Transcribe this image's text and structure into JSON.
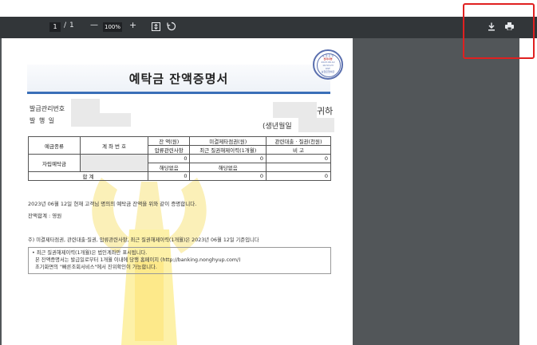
{
  "toolbar": {
    "page_current": "1",
    "page_separator": "/",
    "page_total": "1",
    "zoom_out_label": "—",
    "zoom_value": "100%",
    "zoom_in_label": "+",
    "fit_icon": "fit-page-icon",
    "rotate_icon": "rotate-icon",
    "download_icon": "download-icon",
    "print_icon": "print-icon"
  },
  "document": {
    "title": "예탁금 잔액증명서",
    "issue_no_label": "발급관리번호",
    "issue_date_label": "발   행   일",
    "recipient_suffix": "귀하",
    "birth_label": "(생년월일",
    "seal": {
      "line1": "농 협 은 행",
      "line2": "전자서명",
      "line3": "2023.06.12",
      "line4": "16:53:23",
      "line5": "KST",
      "line6": "농협은행예금"
    },
    "table": {
      "h_deposit_type": "예금종류",
      "h_account_no": "계 좌 번 호",
      "h_balance": "잔 액(원)",
      "h_pledge": "압류관련사항",
      "h_unsettled": "미결제타점권(원)",
      "h_recent": "최근 질권해제이력(1개월)",
      "h_loan": "관련대출 · 질권(천원)",
      "h_remark": "비   고",
      "row_type": "자립예탁금",
      "row_balance": "0",
      "row_unsettled": "0",
      "row_loan": "0",
      "row_none1": "해당없음",
      "row_none2": "해당없음",
      "total_label": "합   계",
      "total_balance": "0",
      "total_unsettled": "0",
      "total_loan": "0"
    },
    "statement": "2023년 06월 12일 현재 고객님 명의의 예탁금 잔액을 위와 같이 증명합니다.",
    "total_text": "잔액합계 : 영원",
    "footnote": "주) 미결제타점권, 관련대출·질권, 압류관련사항, 최근 질권해제이력(1개월)은 2023년 06월 12일 기준입니다",
    "note1": "• 최근 질권해제이력(1개월)은 법인계좌만 표시됩니다.",
    "note2": "  본 잔액증명서는 발급일로부터 1개월 이내에 당행 홈페이지 (http://banking.nonghyup.com/)",
    "note3": "  초기화면의 \"빠른조회서비스\"에서 진위확인이 가능합니다."
  },
  "colors": {
    "toolbar": "#323639",
    "viewer_bg": "#525659",
    "highlight": "#e02020",
    "title_rule": "#3a6fb8"
  }
}
